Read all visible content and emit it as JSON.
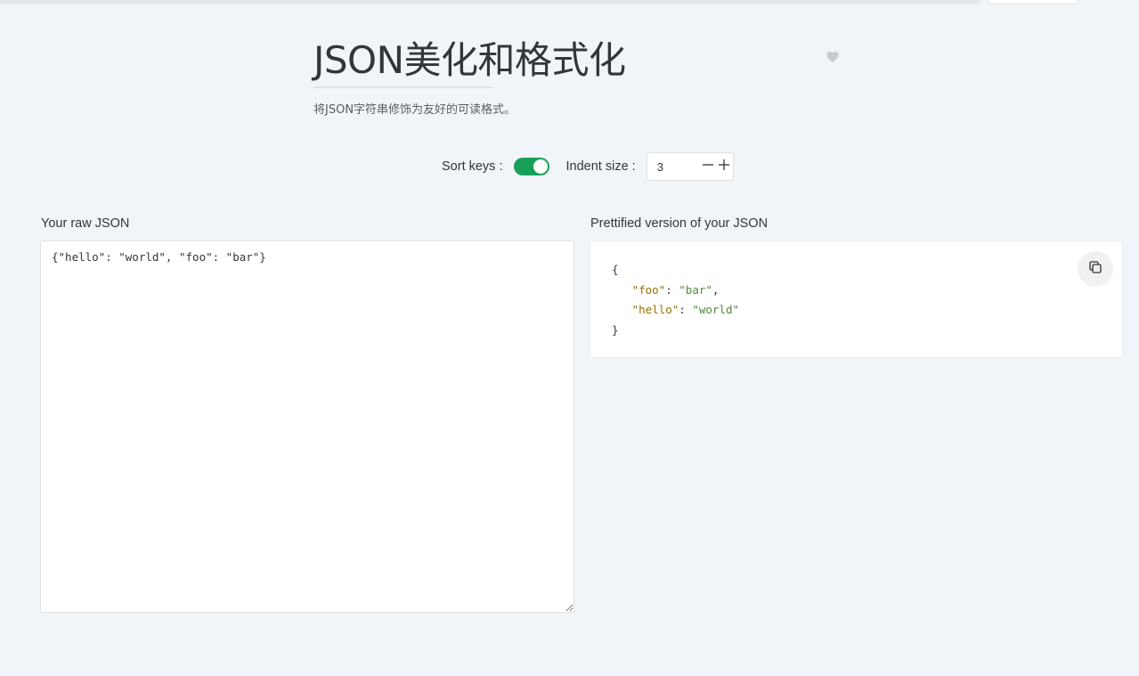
{
  "header": {
    "title": "JSON美化和格式化",
    "description": "将JSON字符串修饰为友好的可读格式。",
    "favorite_icon": "heart-icon"
  },
  "options": {
    "sort_keys_label": "Sort keys :",
    "sort_keys_enabled": true,
    "indent_size_label": "Indent size :",
    "indent_size_value": "3",
    "decrement_icon": "minus-icon",
    "increment_icon": "plus-icon"
  },
  "raw_panel": {
    "label": "Your raw JSON",
    "value": "{\"hello\": \"world\", \"foo\": \"bar\"}"
  },
  "pretty_panel": {
    "label": "Prettified version of your JSON",
    "copy_icon": "copy-icon",
    "lines": {
      "open": "{",
      "close": "}",
      "foo_key": "\"foo\"",
      "foo_value": "\"bar\"",
      "hello_key": "\"hello\"",
      "hello_value": "\"world\""
    }
  },
  "colors": {
    "accent": "#18a058",
    "json_key": "#9a6e00",
    "json_string": "#4f8a3c",
    "background": "#f1f4f8"
  }
}
